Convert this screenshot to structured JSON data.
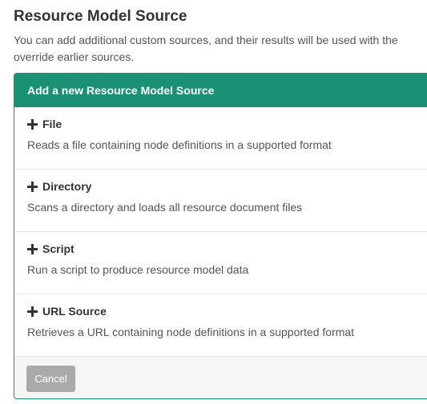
{
  "header": {
    "title": "Resource Model Source",
    "description_line1": "You can add additional custom sources, and their results will be used with the",
    "description_line2": "override earlier sources."
  },
  "panel": {
    "heading": "Add a new Resource Model Source",
    "accent_color": "#1a9172",
    "items": [
      {
        "title": "File",
        "icon": "plus-icon",
        "description": "Reads a file containing node definitions in a supported format"
      },
      {
        "title": "Directory",
        "icon": "plus-icon",
        "description": "Scans a directory and loads all resource document files"
      },
      {
        "title": "Script",
        "icon": "plus-icon",
        "description": "Run a script to produce resource model data"
      },
      {
        "title": "URL Source",
        "icon": "plus-icon",
        "description": "Retrieves a URL containing node definitions in a supported format"
      }
    ]
  },
  "footer": {
    "cancel_label": "Cancel"
  }
}
